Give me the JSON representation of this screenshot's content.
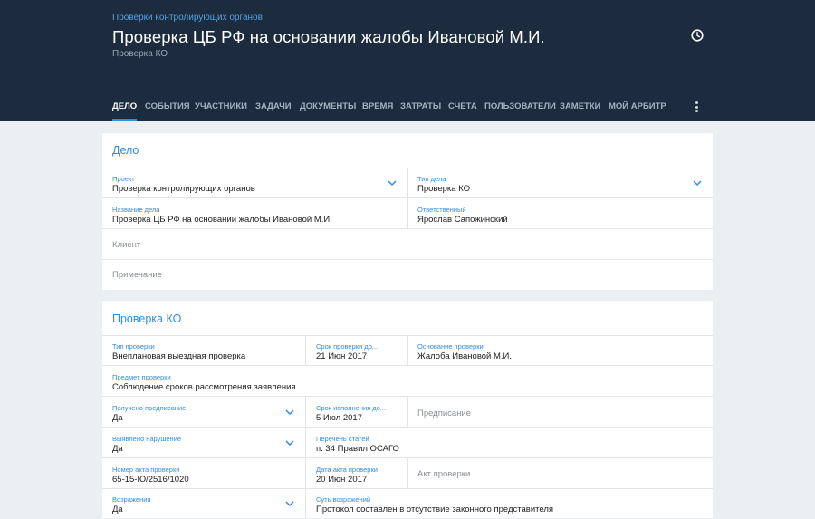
{
  "header": {
    "breadcrumb": "Проверки контролирующих органов",
    "title": "Проверка ЦБ РФ на основании жалобы Ивановой М.И.",
    "subtitle": "Проверка КО",
    "tabs": [
      "ДЕЛО",
      "СОБЫТИЯ",
      "УЧАСТНИКИ",
      "ЗАДАЧИ",
      "ДОКУМЕНТЫ",
      "ВРЕМЯ",
      "ЗАТРАТЫ",
      "СЧЕТА",
      "ПОЛЬЗОВАТЕЛИ",
      "ЗАМЕТКИ",
      "МОЙ АРБИТР"
    ],
    "active_tab": "ДЕЛО"
  },
  "case": {
    "title": "Дело",
    "project_label": "Проект",
    "project_value": "Проверка контролирующих органов",
    "type_label": "Тип дела",
    "type_value": "Проверка КО",
    "name_label": "Название дела",
    "name_value": "Проверка ЦБ РФ на основании жалобы Ивановой М.И.",
    "responsible_label": "Ответственный",
    "responsible_value": "Ярослав Сапожинский",
    "client_placeholder": "Клиент",
    "note_placeholder": "Примечание"
  },
  "inspection": {
    "title": "Проверка КО",
    "type_label": "Тип проверки",
    "type_value": "Внеплановая выездная проверка",
    "deadline_label": "Срок проверки до...",
    "deadline_value": "21 Июн 2017",
    "basis_label": "Основание проверки",
    "basis_value": "Жалоба Ивановой М.И.",
    "subject_label": "Предмет проверки",
    "subject_value": "Соблюдение сроков рассмотрения заявления",
    "order_label": "Получено предписание",
    "order_value": "Да",
    "exec_label": "Срок исполнения до...",
    "exec_value": "5 Июл 2017",
    "order_placeholder": "Предписание",
    "violation_label": "Выявлено нарушение",
    "violation_value": "Да",
    "articles_label": "Перечень статей",
    "articles_value": "п. 34 Правил ОСАГО",
    "act_no_label": "Номер акта проверки",
    "act_no_value": "65-15-Ю/2516/1020",
    "act_date_label": "Дата акта проверки",
    "act_date_value": "20 Июн 2017",
    "act_placeholder": "Акт проверки",
    "objections_label": "Возражения",
    "objections_value": "Да",
    "objections_essence_label": "Суть возражений",
    "objections_essence_value": "Протокол составлен в отсутствие законного представителя"
  },
  "colors": {
    "header_bg": "#1c2b3d",
    "accent": "#2f8ee6",
    "page_bg": "#eceff1"
  },
  "icons": {
    "clock": "clock-icon",
    "menu": "more-vert-icon",
    "dropdown": "chevron-down-icon"
  }
}
